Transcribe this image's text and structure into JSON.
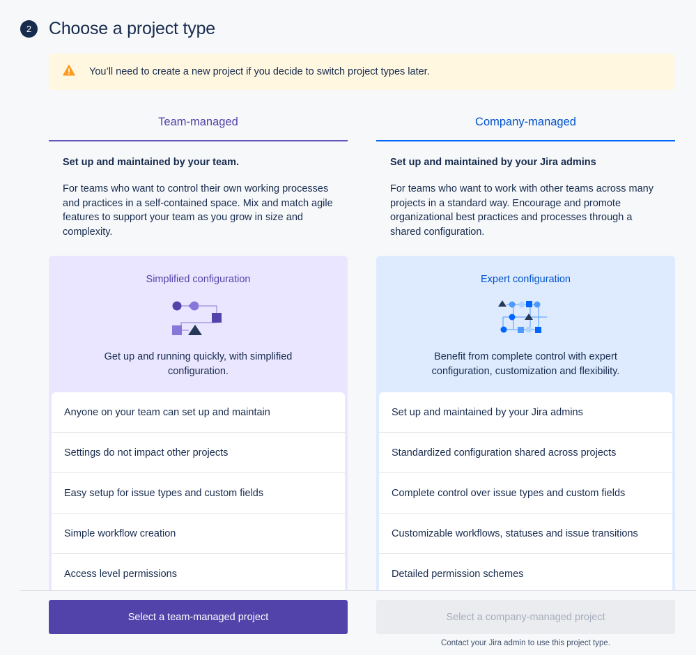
{
  "step": {
    "number": "2",
    "title": "Choose a project type"
  },
  "warning": {
    "text": "You’ll need to create a new project if you decide to switch project types later.",
    "icon": "warning-icon",
    "color": "#ff991f"
  },
  "team": {
    "tab_label": "Team-managed",
    "heading": "Set up and maintained by your team.",
    "description": "For teams who want to control their own working processes and practices in a self-contained space. Mix and match agile features to support your team as you grow in size and complexity.",
    "config_title": "Simplified configuration",
    "config_desc": "Get up and running quickly, with simplified configuration.",
    "features": [
      "Anyone on your team can set up and maintain",
      "Settings do not impact other projects",
      "Easy setup for issue types and custom fields",
      "Simple workflow creation",
      "Access level permissions"
    ],
    "button_label": "Select a team-managed project",
    "accent": "#5243aa"
  },
  "company": {
    "tab_label": "Company-managed",
    "heading": "Set up and maintained by your Jira admins",
    "description": "For teams who want to work with other teams across many projects in a standard way. Encourage and promote organizational best practices and processes through a shared configuration.",
    "config_title": "Expert configuration",
    "config_desc": "Benefit from complete control with expert configuration, customization and flexibility.",
    "features": [
      "Set up and maintained by your Jira admins",
      "Standardized configuration shared across projects",
      "Complete control over issue types and custom fields",
      "Customizable workflows, statuses and issue transitions",
      "Detailed permission schemes"
    ],
    "button_label": "Select a company-managed project",
    "note": "Contact your Jira admin to use this project type.",
    "accent": "#0052cc"
  }
}
